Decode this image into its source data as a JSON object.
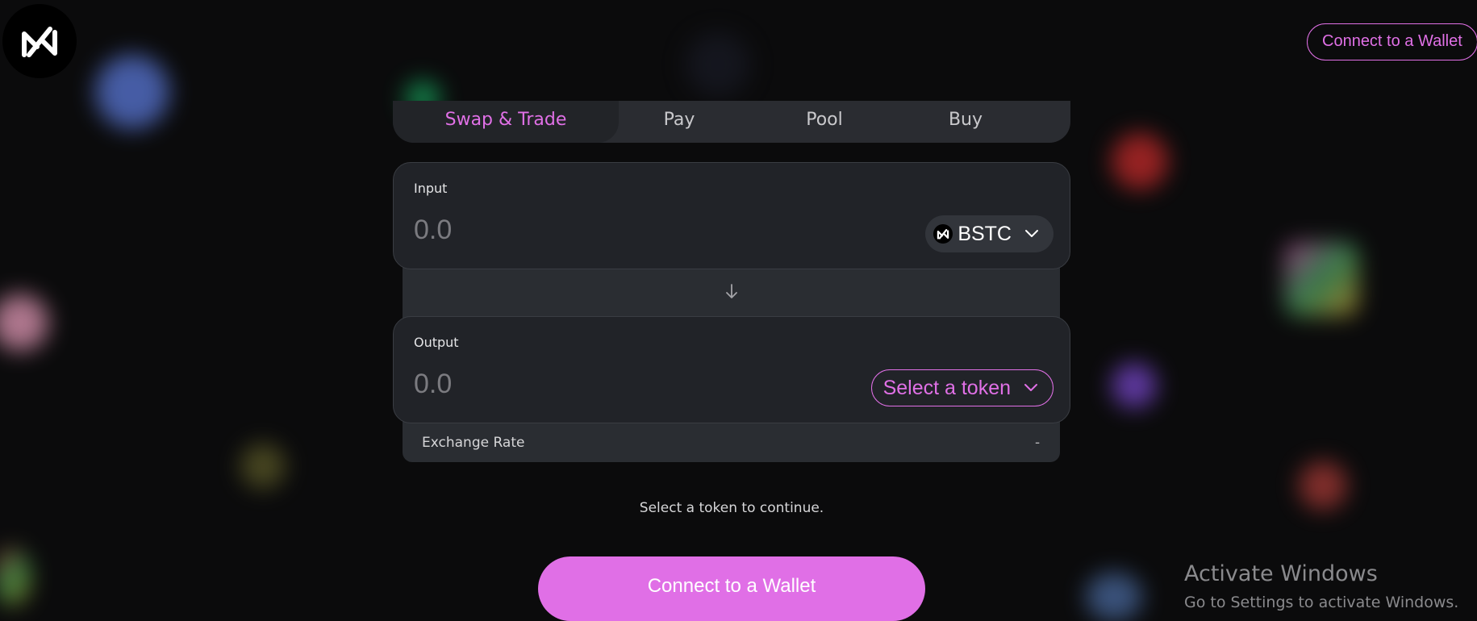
{
  "header": {
    "connect_label": "Connect to a Wallet"
  },
  "tabs": [
    {
      "label": "Swap & Trade",
      "active": true
    },
    {
      "label": "Pay",
      "active": false
    },
    {
      "label": "Pool",
      "active": false
    },
    {
      "label": "Buy",
      "active": false
    }
  ],
  "input_card": {
    "label": "Input",
    "amount_placeholder": "0.0",
    "token": "BSTC"
  },
  "output_card": {
    "label": "Output",
    "amount_placeholder": "0.0",
    "token_select_label": "Select a token"
  },
  "exchange": {
    "label": "Exchange Rate",
    "value": "-"
  },
  "hint": "Select a token to continue.",
  "main_button": {
    "label": "Connect to a Wallet"
  },
  "windows_watermark": {
    "title": "Activate Windows",
    "subtitle": "Go to Settings to activate Windows."
  },
  "colors": {
    "accent": "#e070e6",
    "background": "#0b0b0c",
    "card": "#212328"
  },
  "icons": {
    "logo": "brand-logo-icon",
    "token": "bstc-token-icon",
    "dropdown": "chevron-down-icon",
    "swap_direction": "arrow-down-icon"
  }
}
